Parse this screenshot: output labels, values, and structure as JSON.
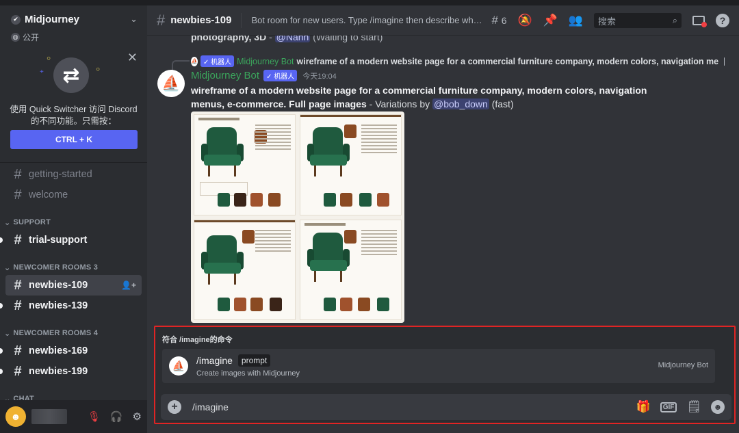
{
  "window": {
    "controls": [
      "—",
      "☐",
      "✕"
    ]
  },
  "server": {
    "name": "Midjourney",
    "visibility": "公开",
    "quick_switcher": {
      "text_line1": "使用 Quick Switcher 访问 Discord",
      "text_line2": "的不同功能。只需按：",
      "shortcut": "CTRL + K"
    }
  },
  "sidebar": {
    "channels_top": [
      {
        "name": "getting-started"
      },
      {
        "name": "welcome"
      }
    ],
    "categories": [
      {
        "label": "SUPPORT",
        "channels": [
          {
            "name": "trial-support"
          }
        ]
      },
      {
        "label": "NEWCOMER ROOMS 3",
        "channels": [
          {
            "name": "newbies-109"
          },
          {
            "name": "newbies-139"
          }
        ]
      },
      {
        "label": "NEWCOMER ROOMS 4",
        "channels": [
          {
            "name": "newbies-169"
          },
          {
            "name": "newbies-199"
          }
        ]
      },
      {
        "label": "CHAT"
      }
    ]
  },
  "header": {
    "channel": "newbies-109",
    "topic": "Bot room for new users. Type /imagine then describe what yo...",
    "thread_count": "6",
    "search_placeholder": "搜索"
  },
  "messages": {
    "previous_line": {
      "prompt_tail": "photography, 3D",
      "mention": "@Nahh",
      "status": "(Waiting to start)"
    },
    "reply": {
      "bot_badge": "✓ 机器人",
      "author": "Midjourney Bot",
      "text": "wireframe of a modern website page for a commercial furniture company, modern colors, navigation me"
    },
    "main": {
      "author": "Midjourney Bot",
      "bot_badge": "✓ 机器人",
      "timestamp": "今天19:04",
      "prompt": "wireframe of a modern website page for a commercial furniture company, modern colors, navigation menus, e-commerce. Full page images",
      "suffix_before": " - Variations by ",
      "mention": "@bob_down",
      "suffix_after": " (fast)"
    }
  },
  "command_panel": {
    "title": "符合 /imagine的命令",
    "command": "/imagine",
    "option": "prompt",
    "description": "Create images with Midjourney",
    "source": "Midjourney Bot"
  },
  "composer": {
    "value": "/imagine"
  },
  "user": {
    "avatar": "☻"
  }
}
